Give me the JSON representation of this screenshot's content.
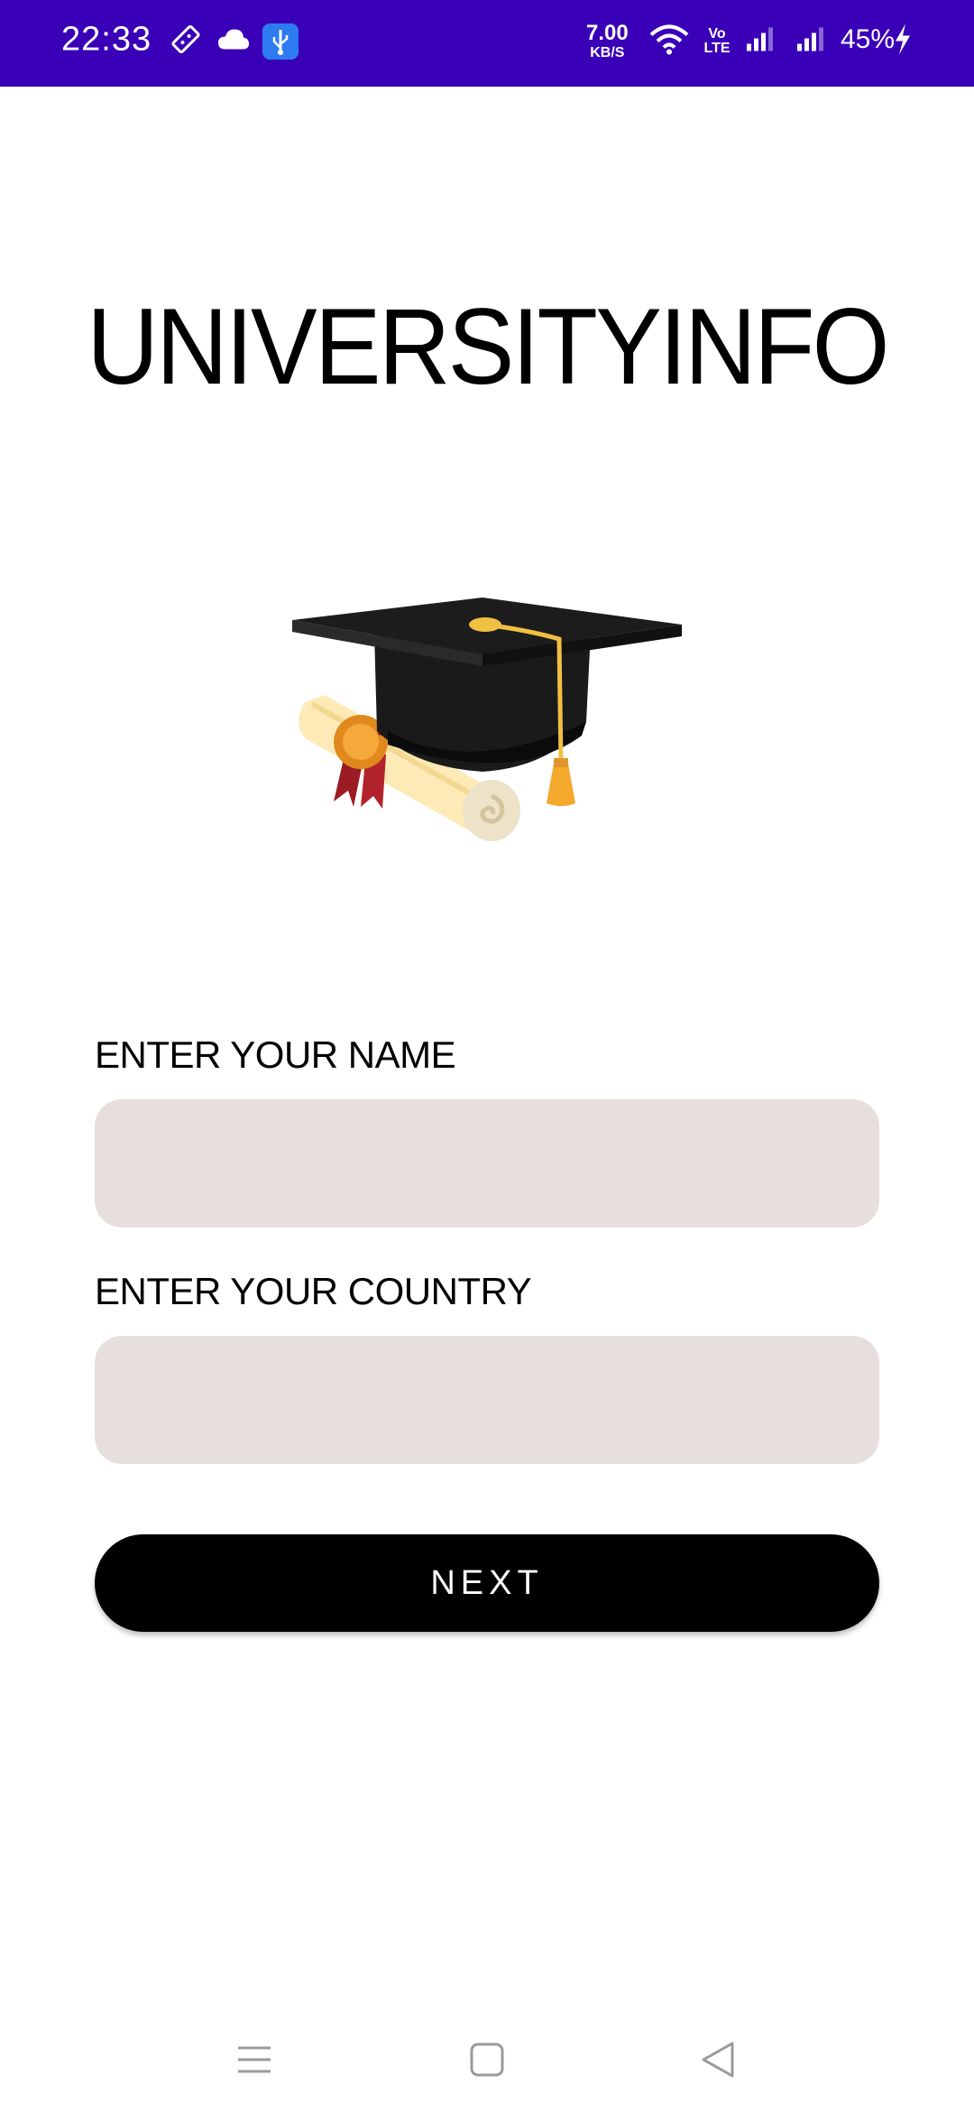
{
  "status_bar": {
    "time": "22:33",
    "net_speed_value": "7.00",
    "net_speed_unit": "KB/S",
    "volte_label": "Vo LTE",
    "battery": "45%",
    "icons": [
      "notification-icon",
      "cloud-icon",
      "usb-icon",
      "wifi-icon",
      "volte-icon",
      "signal-icon",
      "signal-icon",
      "charging-icon"
    ],
    "background_color": "#3a00b8"
  },
  "app": {
    "title": "UNIVERSITYINFO"
  },
  "form": {
    "name_label": "ENTER YOUR NAME",
    "name_value": "",
    "country_label": "ENTER YOUR COUNTRY",
    "country_value": "",
    "next_label": "NEXT",
    "input_background": "#e6dfdd"
  },
  "nav_bar": {
    "icons": [
      "menu-icon",
      "home-icon",
      "back-icon"
    ]
  }
}
